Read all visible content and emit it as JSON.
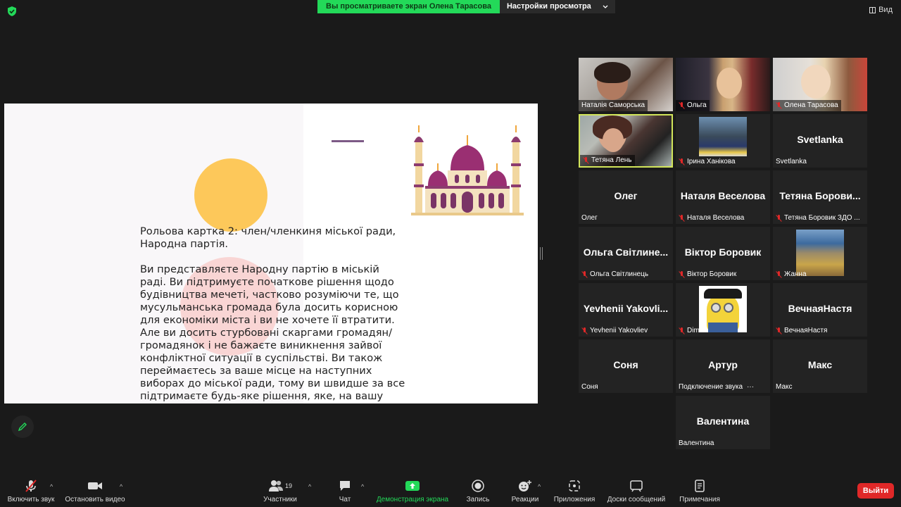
{
  "top_bar": {
    "share_notice": "Вы просматриваете экран Олена Тарасова",
    "view_settings_label": "Настройки просмотра",
    "view_label": "Вид"
  },
  "slide": {
    "paragraph1": "Рольова картка 2: член/членкиня міської ради, Народна партія.",
    "paragraph2": "Ви представляєте Народну партію в міській раді. Ви підтримуєте початкове рішення щодо будівництва мечеті, частково розуміючи те, що мусульманська громада була досить корисною для економіки міста і ви не хочете її втратити. Але ви досить стурбовані скаргами громадян/громадянок і не бажаєте виникнення зайвої конфліктної ситуації в суспільстві. Ви також переймаєтесь за ваше місце на наступних виборах до міської ради, тому ви швидше за все підтримаєте будь-яке рішення, яке, на вашу думку, буде найменш суперечливим.",
    "accent_yellow": "#fdc85a",
    "accent_pink": "#f9c6c4",
    "accent_purple": "#7d5a86"
  },
  "participants": [
    {
      "name": "Наталія Саморська",
      "muted": false,
      "video": true
    },
    {
      "name": "Ольга",
      "muted": true,
      "video": true
    },
    {
      "name": "Олена Тарасова",
      "muted": true,
      "video": true
    },
    {
      "name": "Тетяна Лень",
      "muted": true,
      "video": true,
      "active": true
    },
    {
      "name": "Ірина Ханікова",
      "muted": true,
      "video": true
    },
    {
      "name": "Svetlanka",
      "display": "Svetlanka",
      "muted": false,
      "video": false
    },
    {
      "name": "Олег",
      "display": "Олег",
      "muted": false,
      "video": false
    },
    {
      "name": "Наталя Веселова",
      "display": "Наталя Веселова",
      "muted": true,
      "video": false
    },
    {
      "name": "Тетяна Боровик ЗДО ...",
      "display": "Тетяна Борови...",
      "muted": true,
      "video": false
    },
    {
      "name": "Ольга Світлинець",
      "display": "Ольга Світлине...",
      "muted": true,
      "video": false
    },
    {
      "name": "Віктор Боровик",
      "display": "Віктор Боровик",
      "muted": true,
      "video": false
    },
    {
      "name": "Жанна",
      "muted": true,
      "video": true
    },
    {
      "name": "Yevhenii Yakovliev",
      "display": "Yevhenii Yakovli...",
      "muted": true,
      "video": false
    },
    {
      "name": "Dima",
      "muted": true,
      "video": true
    },
    {
      "name": "ВечнаяНастя",
      "display": "ВечнаяНастя",
      "muted": true,
      "video": false
    },
    {
      "name": "Соня",
      "display": "Соня",
      "muted": false,
      "video": false
    },
    {
      "name": "Подключение звука",
      "display": "Артур",
      "muted": false,
      "video": false
    },
    {
      "name": "Макс",
      "display": "Макс",
      "muted": false,
      "video": false
    },
    {
      "name": "Валентина",
      "display": "Валентина",
      "muted": false,
      "video": false
    }
  ],
  "toolbar": {
    "mute_label": "Включить звук",
    "video_label": "Остановить видео",
    "participants_label": "Участники",
    "participants_count": "19",
    "chat_label": "Чат",
    "share_label": "Демонстрация экрана",
    "record_label": "Запись",
    "reactions_label": "Реакции",
    "apps_label": "Приложения",
    "whiteboards_label": "Доски сообщений",
    "notes_label": "Примечания",
    "leave_label": "Выйти"
  },
  "colors": {
    "share_green": "#23d959",
    "leave_red": "#e02828",
    "active_speaker": "#d2e55a"
  }
}
